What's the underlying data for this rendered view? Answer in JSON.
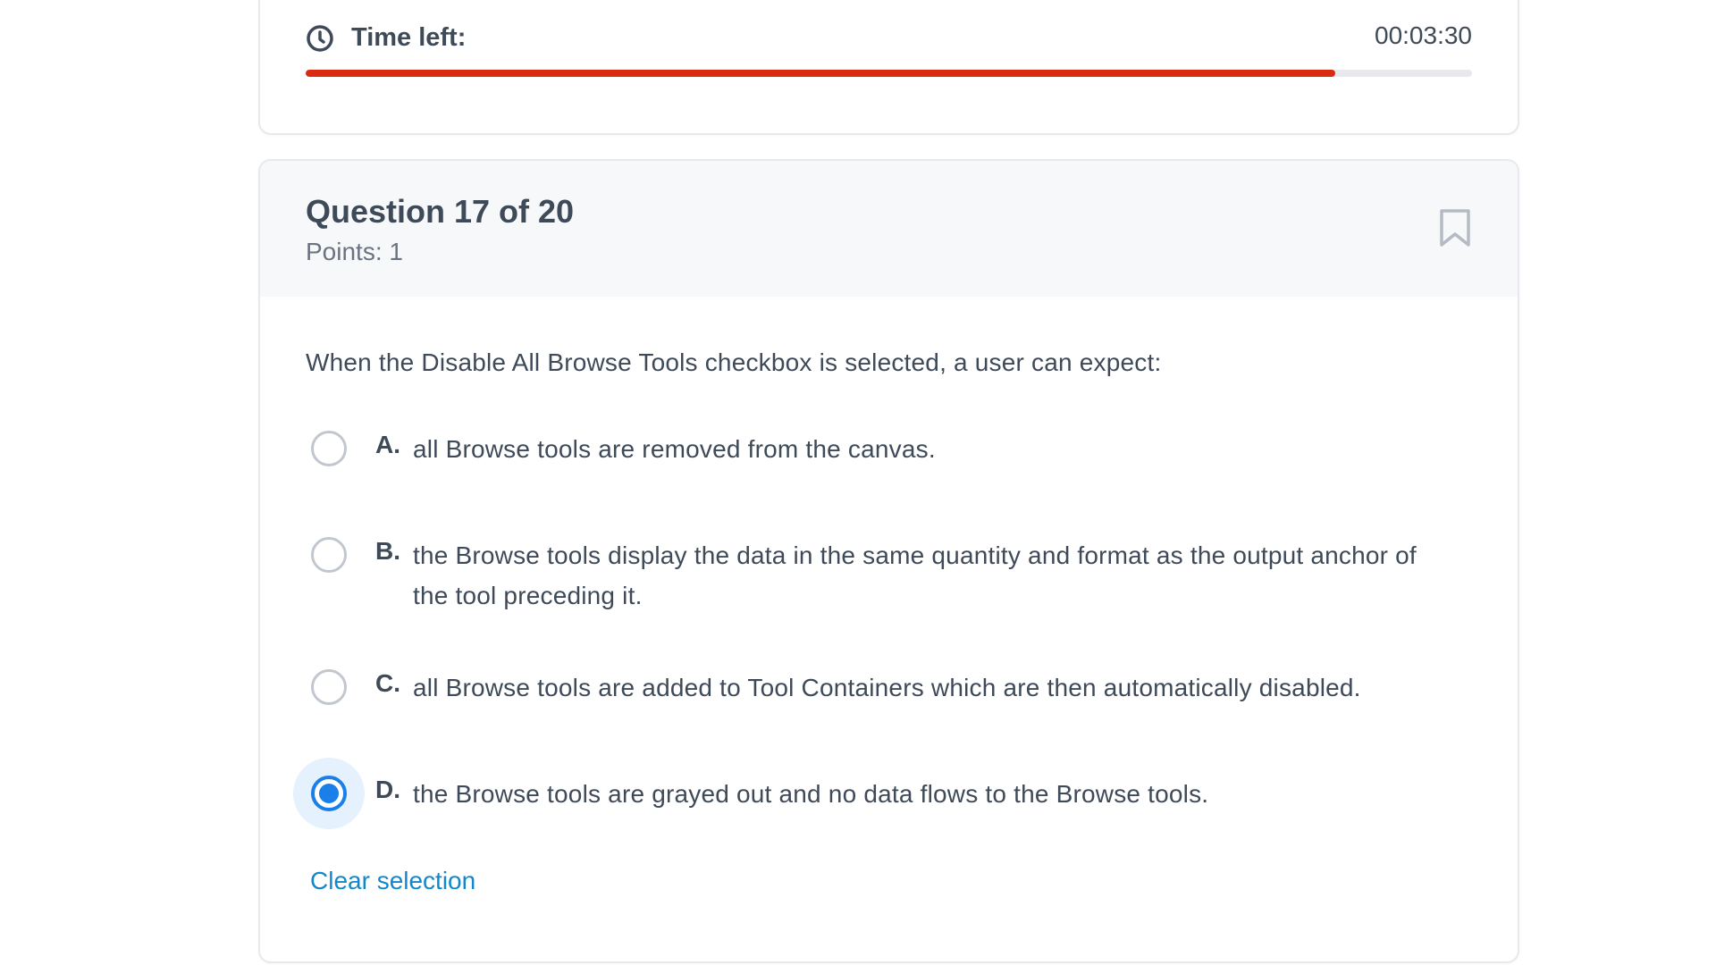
{
  "timer": {
    "label": "Time left:",
    "value": "00:03:30",
    "progress_percent": 88.3,
    "bar_color": "#d92a12",
    "icon": "clock-icon"
  },
  "question": {
    "title": "Question 17 of 20",
    "points": "Points: 1",
    "bookmark_icon": "bookmark-icon",
    "text": "When the Disable All Browse Tools checkbox is selected, a user can expect:",
    "options": [
      {
        "letter": "A.",
        "text": "all Browse tools are removed from the canvas.",
        "selected": false
      },
      {
        "letter": "B.",
        "text": "the Browse tools display the data in the same quantity and format as the output anchor of the tool preceding it.",
        "selected": false
      },
      {
        "letter": "C.",
        "text": "all Browse tools are added to Tool Containers which are then automatically disabled.",
        "selected": false
      },
      {
        "letter": "D.",
        "text": "the Browse tools are grayed out and no data flows to the Browse tools.",
        "selected": true
      }
    ],
    "clear_label": "Clear selection",
    "accent_color": "#1a7fe8"
  }
}
